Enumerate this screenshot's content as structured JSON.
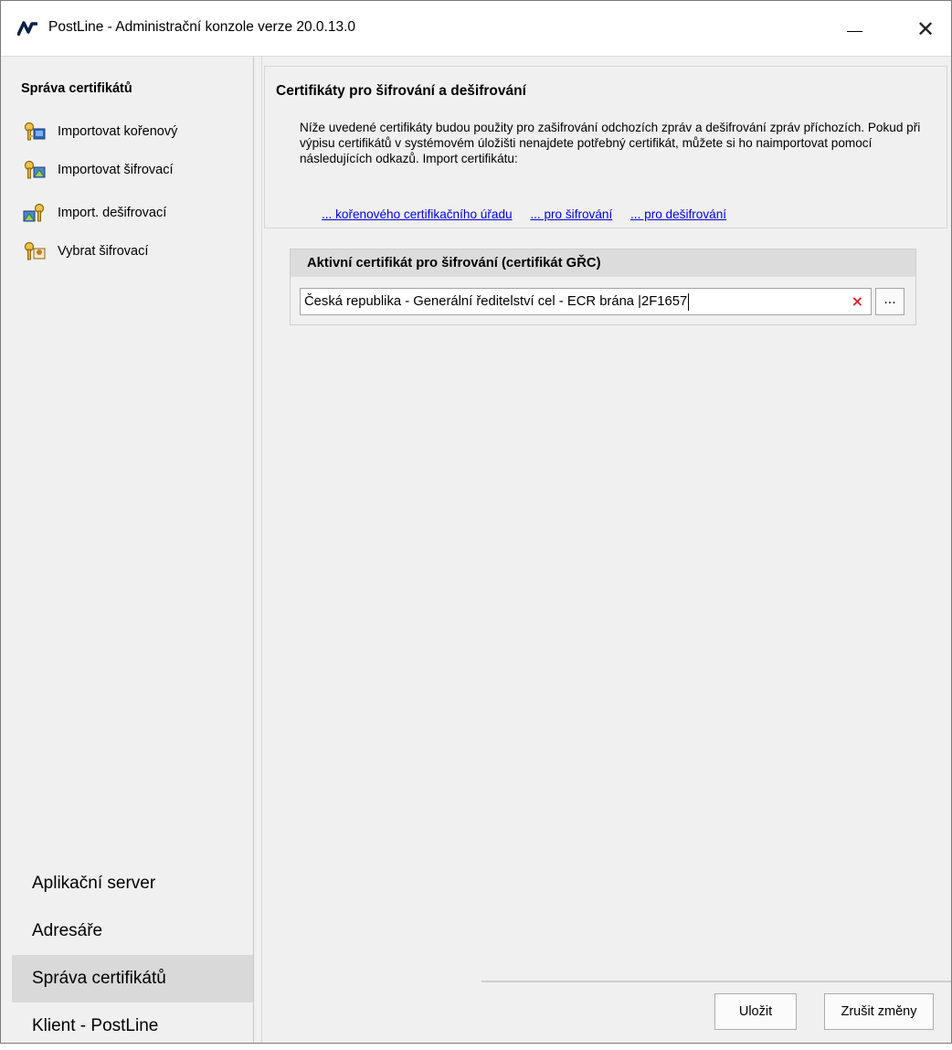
{
  "window": {
    "title": "PostLine - Administrační konzole verze 20.0.13.0",
    "minimize_glyph": "—",
    "close_glyph": "✕"
  },
  "sidebar": {
    "heading": "Správa certifikátů",
    "items": [
      {
        "label": "Importovat kořenový",
        "icon": "key-certificate-icon"
      },
      {
        "label": "Importovat šifrovací",
        "icon": "key-encrypt-icon"
      },
      {
        "label": "Import. dešifrovací",
        "icon": "key-decrypt-icon"
      },
      {
        "label": "Vybrat šifrovací",
        "icon": "key-select-icon"
      }
    ],
    "nav": [
      {
        "label": "Aplikační server",
        "active": false
      },
      {
        "label": "Adresáře",
        "active": false
      },
      {
        "label": "Správa certifikátů",
        "active": true
      },
      {
        "label": "Klient - PostLine",
        "active": false
      }
    ]
  },
  "main": {
    "info": {
      "title": "Certifikáty  pro  šifrování a dešifrování",
      "text": "Níže uvedené certifikáty budou použity pro zašifrování odchozích zpráv a dešifrování zpráv příchozích.  Pokud při výpisu certifikátů v systémovém úložišti nenajdete potřebný certifikát, můžete si ho naimportovat pomocí následujících odkazů. Import certifikátu:",
      "links": [
        "... kořenového certifikačního úřadu",
        "... pro šifrování",
        "... pro dešifrování"
      ]
    },
    "certificate": {
      "header": "Aktivní certifikát pro šifrování  (certifikát GŘC)",
      "value": "Česká republika - Generální ředitelství cel - ECR brána |2F1657",
      "clear_glyph": "×",
      "browse_label": "..."
    },
    "buttons": {
      "save": "Uložit",
      "cancel": "Zrušit změny"
    }
  },
  "colors": {
    "sidebar_bg": "#f0f0f0",
    "active_nav_bg": "#d9d9d9",
    "link": "#0000ee",
    "clear_x": "#d9232e"
  }
}
